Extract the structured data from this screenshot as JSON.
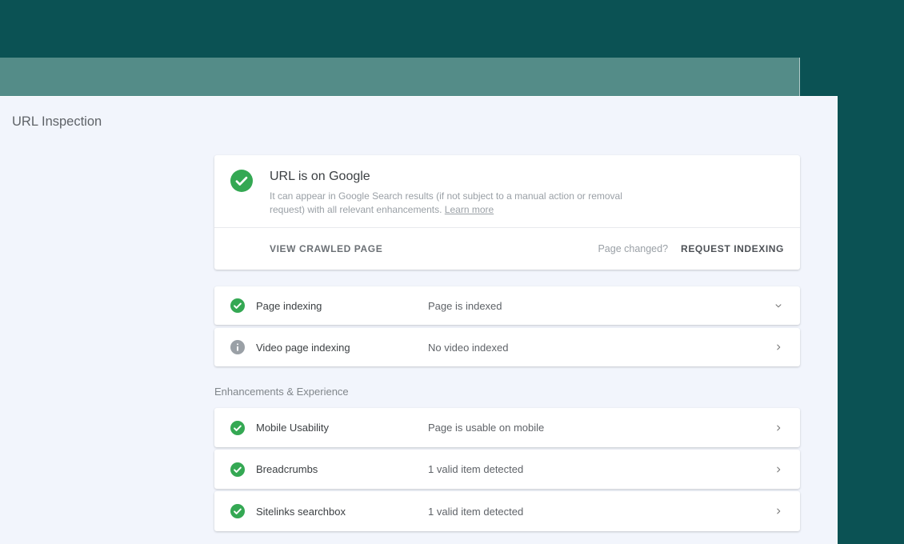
{
  "page": {
    "title": "URL Inspection"
  },
  "colors": {
    "top_band": "#0b5254",
    "secondary_band": "#548c88",
    "content_bg": "#f2f5fc",
    "success_green": "#34a853",
    "info_gray": "#9aa0a6"
  },
  "status_card": {
    "icon": "check-circle",
    "title": "URL is on Google",
    "description": "It can appear in Google Search results (if not subject to a manual action or removal request) with all relevant enhancements.",
    "learn_more_label": "Learn more",
    "view_crawled_label": "VIEW CRAWLED PAGE",
    "page_changed_label": "Page changed?",
    "request_indexing_label": "REQUEST INDEXING"
  },
  "index_rows": [
    {
      "icon": "check-circle",
      "label": "Page indexing",
      "value": "Page is indexed",
      "chevron": "down",
      "expanded": true
    },
    {
      "icon": "info-circle",
      "label": "Video page indexing",
      "value": "No video indexed",
      "chevron": "right",
      "expanded": false
    }
  ],
  "enhancements": {
    "section_label": "Enhancements & Experience",
    "rows": [
      {
        "icon": "check-circle",
        "label": "Mobile Usability",
        "value": "Page is usable on mobile",
        "chevron": "right"
      },
      {
        "icon": "check-circle",
        "label": "Breadcrumbs",
        "value": "1 valid item detected",
        "chevron": "right"
      },
      {
        "icon": "check-circle",
        "label": "Sitelinks searchbox",
        "value": "1 valid item detected",
        "chevron": "right"
      }
    ]
  }
}
